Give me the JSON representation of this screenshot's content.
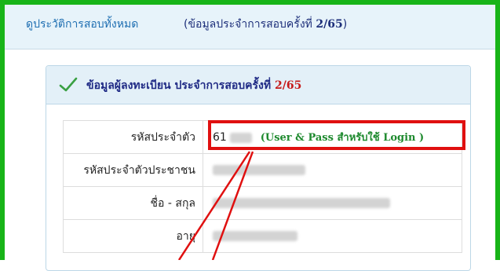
{
  "header": {
    "history_link": "ดูประวัติการสอบทั้งหมด",
    "history_note_prefix": "(ข้อมูลประจำการสอบครั้งที่",
    "history_note_round": "2/65",
    "history_note_suffix": ")"
  },
  "panel": {
    "title_prefix": "ข้อมูลผู้ลงทะเบียน ประจำการสอบครั้งที่",
    "title_round": "2/65",
    "check_icon": "check-icon"
  },
  "rows": [
    {
      "label": "รหัสประจำตัว",
      "value_visible": "61",
      "note": "(User & Pass สำหรับใช้ Login )"
    },
    {
      "label": "รหัสประจำตัวประชาชน"
    },
    {
      "label": "ชื่อ - สกุล"
    },
    {
      "label": "อายุ"
    }
  ],
  "colors": {
    "frame_border": "#18b418",
    "highlight_box": "#e01010",
    "title_text": "#1f2a85",
    "round_number": "#c61b1b",
    "login_note": "#1f8a2f"
  }
}
